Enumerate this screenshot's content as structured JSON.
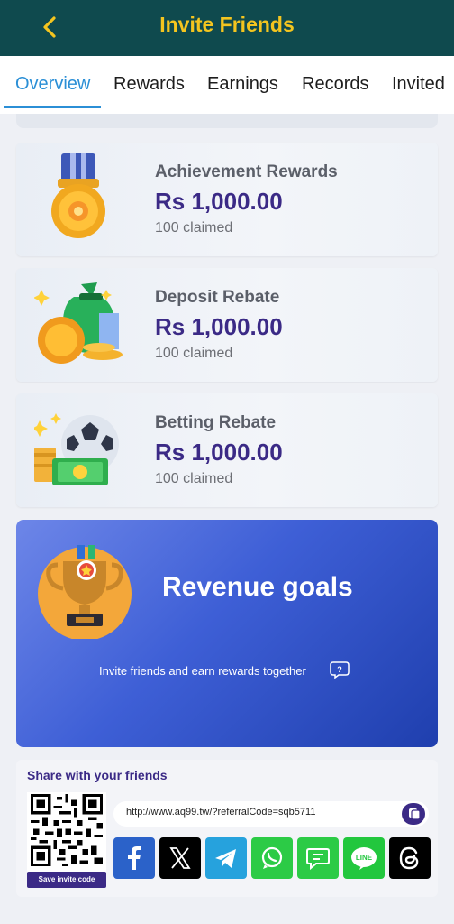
{
  "header": {
    "title": "Invite Friends",
    "back_icon": "chevron-left-icon"
  },
  "tabs": [
    {
      "label": "Overview",
      "active": true
    },
    {
      "label": "Rewards",
      "active": false
    },
    {
      "label": "Earnings",
      "active": false
    },
    {
      "label": "Records",
      "active": false
    },
    {
      "label": "Invited",
      "active": false
    }
  ],
  "cards": [
    {
      "title": "Achievement Rewards",
      "amount": "Rs  1,000.00",
      "claimed": "100 claimed",
      "icon": "medal-icon"
    },
    {
      "title": "Deposit Rebate",
      "amount": "Rs  1,000.00",
      "claimed": "100 claimed",
      "icon": "money-bag-icon"
    },
    {
      "title": "Betting Rebate",
      "amount": "Rs  1,000.00",
      "claimed": "100 claimed",
      "icon": "football-cash-icon"
    }
  ],
  "revenue": {
    "title": "Revenue goals",
    "subtitle": "Invite friends and earn rewards together",
    "help_icon": "question-bubble-icon",
    "trophy_icon": "trophy-icon"
  },
  "share": {
    "title": "Share with your friends",
    "qr_button": "Save invite code",
    "url": "http://www.aq99.tw/?referralCode=sqb5711",
    "copy_icon": "copy-icon",
    "socials": [
      {
        "name": "facebook",
        "color": "#2b62c9"
      },
      {
        "name": "x",
        "color": "#000000"
      },
      {
        "name": "telegram",
        "color": "#26a2dd"
      },
      {
        "name": "whatsapp",
        "color": "#2ccb46"
      },
      {
        "name": "sms",
        "color": "#2ccb46"
      },
      {
        "name": "line",
        "color": "#22c73e"
      },
      {
        "name": "threads",
        "color": "#000000"
      }
    ]
  },
  "colors": {
    "header_bg": "#0f4a4e",
    "title": "#f4c51f",
    "tab_active": "#2b8fd6",
    "amount": "#3b2a86"
  }
}
